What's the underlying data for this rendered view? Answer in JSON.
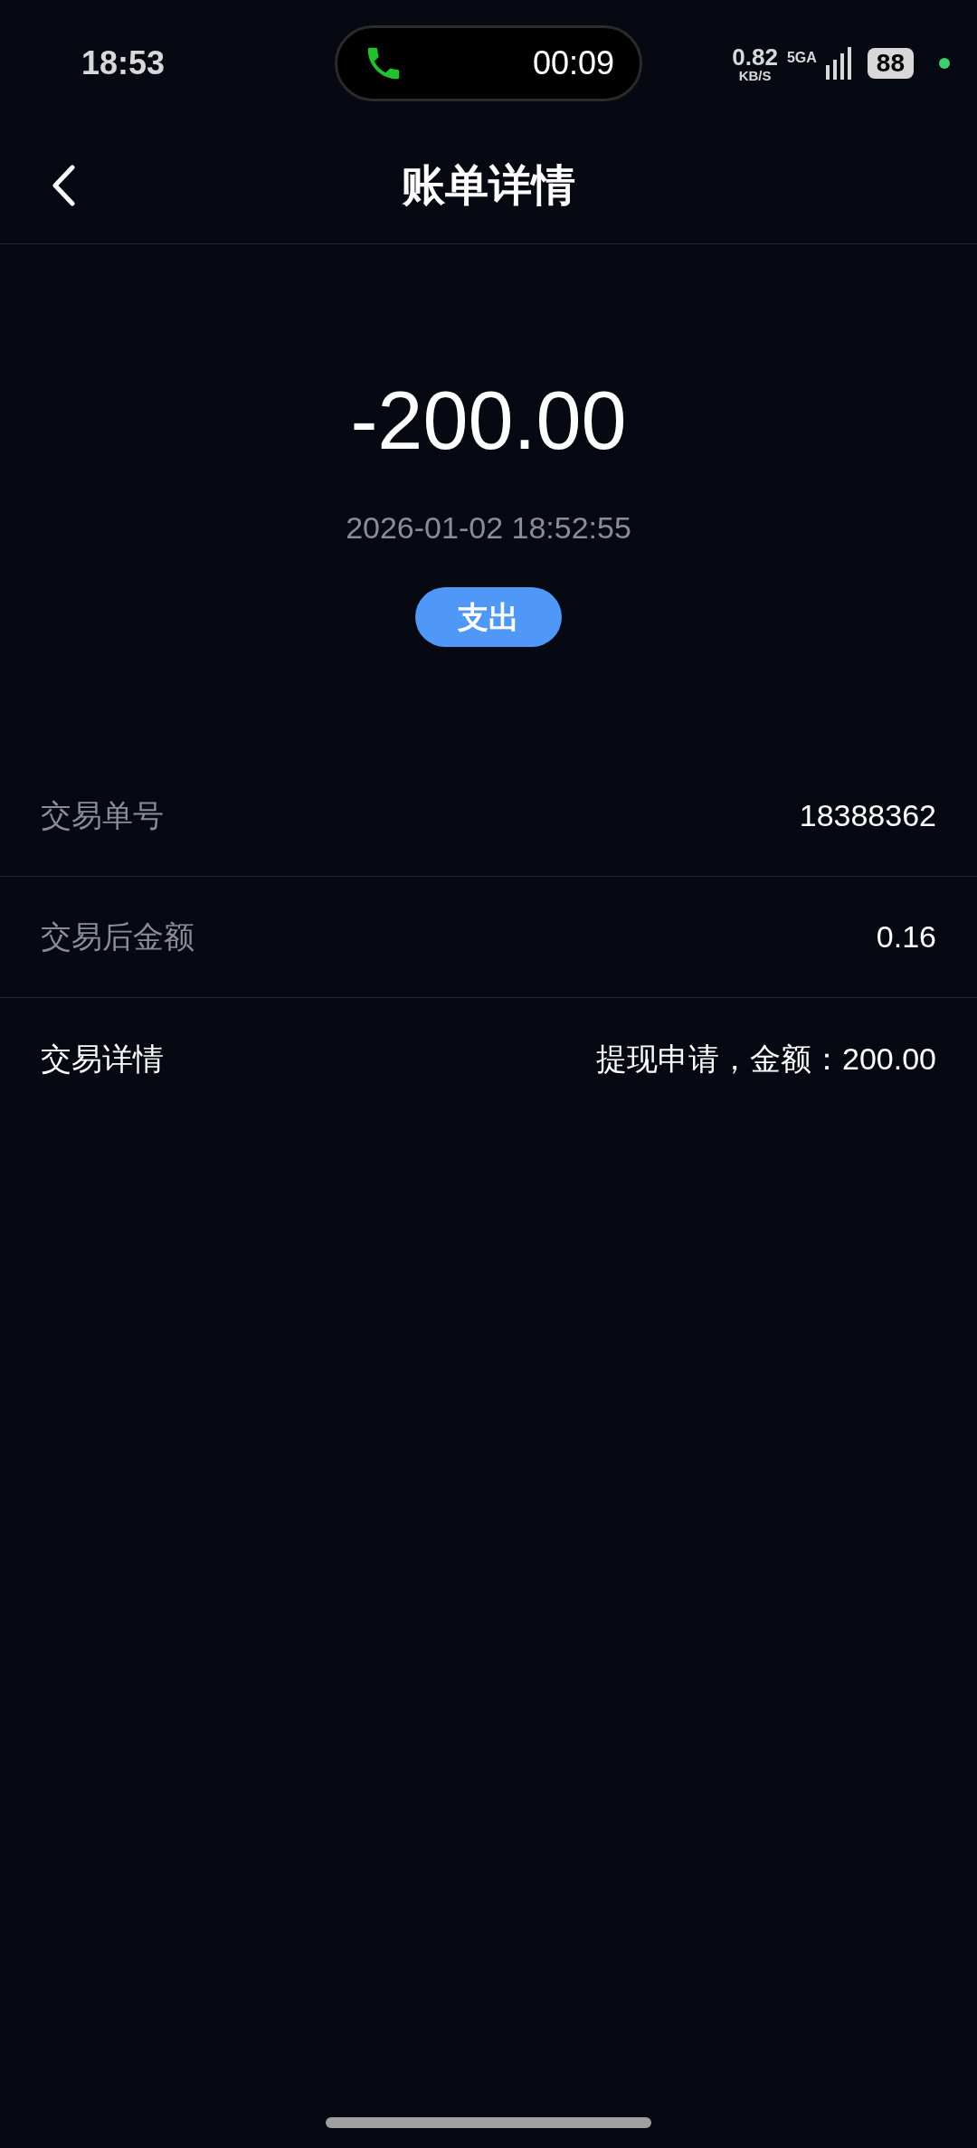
{
  "status_bar": {
    "time": "18:53",
    "call_timer": "00:09",
    "net_speed": "0.82",
    "net_speed_unit": "KB/S",
    "network": "5GA",
    "battery": "88"
  },
  "header": {
    "title": "账单详情"
  },
  "summary": {
    "amount": "-200.00",
    "datetime": "2026-01-02 18:52:55",
    "badge": "支出"
  },
  "rows": [
    {
      "label": "交易单号",
      "value": "18388362",
      "highlighted": false
    },
    {
      "label": "交易后金额",
      "value": "0.16",
      "highlighted": false
    },
    {
      "label": "交易详情",
      "value": "提现申请，金额：200.00",
      "highlighted": true
    }
  ]
}
